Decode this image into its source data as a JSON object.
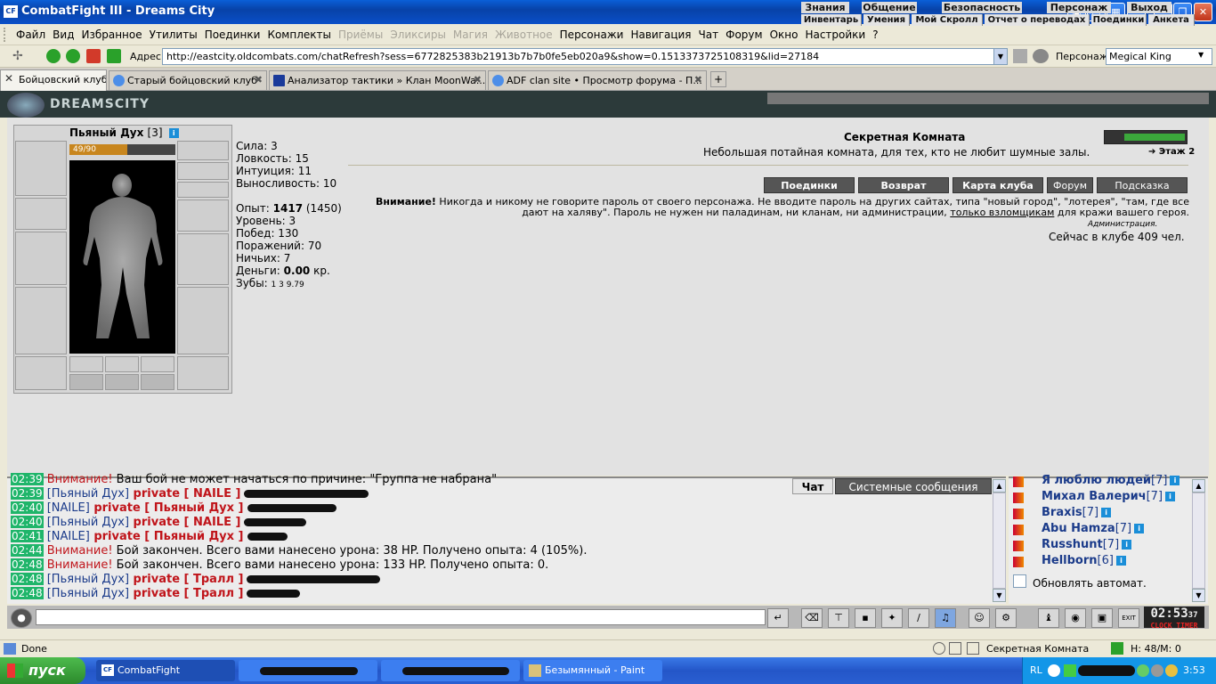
{
  "window": {
    "title": "CombatFight III - Dreams City",
    "app_icon": "CF"
  },
  "menu": {
    "items": [
      {
        "label": "Файл",
        "disabled": false
      },
      {
        "label": "Вид",
        "disabled": false
      },
      {
        "label": "Избранное",
        "disabled": false
      },
      {
        "label": "Утилиты",
        "disabled": false
      },
      {
        "label": "Поединки",
        "disabled": false
      },
      {
        "label": "Комплекты",
        "disabled": false
      },
      {
        "label": "Приёмы",
        "disabled": true
      },
      {
        "label": "Эликсиры",
        "disabled": true
      },
      {
        "label": "Магия",
        "disabled": true
      },
      {
        "label": "Животное",
        "disabled": true
      },
      {
        "label": "Персонажи",
        "disabled": false
      },
      {
        "label": "Навигация",
        "disabled": false
      },
      {
        "label": "Чат",
        "disabled": false
      },
      {
        "label": "Форум",
        "disabled": false
      },
      {
        "label": "Окно",
        "disabled": false
      },
      {
        "label": "Настройки",
        "disabled": false
      },
      {
        "label": "?",
        "disabled": false
      }
    ]
  },
  "address": {
    "label": "Адрес:",
    "url": "http://eastcity.oldcombats.com/chatRefresh?sess=6772825383b21913b7b7b0fe5eb020a9&show=0.1513373725108319&lid=27184",
    "char_label": "Персонаж:",
    "char_value": "Megical King"
  },
  "tabs": [
    {
      "label": "Бойцовский клуб",
      "active": true
    },
    {
      "label": "Старый бойцовский клуб",
      "active": false
    },
    {
      "label": "Анализатор тактики » Клан MoonWa...",
      "active": false
    },
    {
      "label": "ADF clan site • Просмотр форума - П...",
      "active": false
    }
  ],
  "game": {
    "logo": "DREAMSCITY",
    "topnav": [
      "Знания",
      "Общение",
      "Безопасность",
      "Персонаж",
      "Выход"
    ],
    "subnav": [
      "Инвентарь",
      "Умения",
      "Мой Скролл",
      "Отчет о переводах",
      "Поединки",
      "Анкета"
    ]
  },
  "character": {
    "name": "Пьяный Дух",
    "level": "[3]",
    "hp_text": "49/90",
    "hp_fraction": 0.544,
    "stats": [
      {
        "label": "Сила:",
        "value": "3"
      },
      {
        "label": "Ловкость:",
        "value": "15"
      },
      {
        "label": "Интуиция:",
        "value": "11"
      },
      {
        "label": "Выносливость:",
        "value": "10"
      }
    ],
    "exp_label": "Опыт:",
    "exp": "1417",
    "exp_next": "(1450)",
    "level_line": "Уровень: 3",
    "wins": "Побед: 130",
    "losses": "Поражений: 70",
    "draws": "Ничьих: 7",
    "money_label": "Деньги:",
    "money": "0.00",
    "money_unit": "кр.",
    "teeth_label": "Зубы:",
    "teeth": "1  3  9.79"
  },
  "room": {
    "title": "Секретная Комната",
    "desc": "Небольшая потайная комната, для тех, кто не любит шумные залы.",
    "floor": "Этаж 2",
    "buttons": [
      "Поединки",
      "Возврат",
      "Карта клуба",
      "Форум",
      "Подсказка"
    ],
    "warn_bold": "Внимание!",
    "warn_text": "Никогда и никому не говорите пароль от своего персонажа. Не вводите пароль на других сайтах, типа \"новый город\", \"лотерея\", \"там, где все дают на халяву\". Пароль не нужен ни паладинам, ни кланам, ни администрации,",
    "warn_link": "только взломщикам",
    "warn_tail": "для кражи вашего героя.",
    "admin": "Администрация.",
    "online": "Сейчас в клубе 409 чел."
  },
  "chat": {
    "tab_chat": "Чат",
    "tab_system": "Системные сообщения",
    "lines": [
      {
        "time": "02:39",
        "parts": [
          {
            "t": "Внимание!",
            "c": "cwarn"
          },
          {
            "t": " Ваш бой не может начаться по причине: \"Группа не набрана\"",
            "c": ""
          }
        ]
      },
      {
        "time": "02:39",
        "parts": [
          {
            "t": "[Пьяный Дух]",
            "c": "cname"
          },
          {
            "t": " private [ NAILE ]",
            "c": "cpriv"
          }
        ],
        "blur": 140
      },
      {
        "time": "02:40",
        "parts": [
          {
            "t": "[NAILE]",
            "c": "cname"
          },
          {
            "t": " private [ Пьяный Дух ]",
            "c": "cpriv"
          }
        ],
        "blur": 100
      },
      {
        "time": "02:40",
        "parts": [
          {
            "t": "[Пьяный Дух]",
            "c": "cname"
          },
          {
            "t": " private [ NAILE ]",
            "c": "cpriv"
          }
        ],
        "blur": 70
      },
      {
        "time": "02:41",
        "parts": [
          {
            "t": "[NAILE]",
            "c": "cname"
          },
          {
            "t": " private [ Пьяный Дух ]",
            "c": "cpriv"
          }
        ],
        "blur": 45
      },
      {
        "time": "02:44",
        "parts": [
          {
            "t": "Внимание!",
            "c": "cwarn"
          },
          {
            "t": " Бой закончен. Всего вами нанесено урона: 38 HP. Получено опыта: 4 (105%).",
            "c": ""
          }
        ]
      },
      {
        "time": "02:48",
        "parts": [
          {
            "t": "Внимание!",
            "c": "cwarn"
          },
          {
            "t": " Бой закончен. Всего вами нанесено урона: 133 HP. Получено опыта: 0.",
            "c": ""
          }
        ]
      },
      {
        "time": "02:48",
        "parts": [
          {
            "t": "[Пьяный Дух]",
            "c": "cname"
          },
          {
            "t": " private [ Тралл ]",
            "c": "cpriv"
          }
        ],
        "blur": 150
      },
      {
        "time": "02:48",
        "parts": [
          {
            "t": "[Пьяный Дух]",
            "c": "cname"
          },
          {
            "t": " private [ Тралл ]",
            "c": "cpriv"
          }
        ],
        "blur": 60
      }
    ]
  },
  "users": {
    "list": [
      {
        "name": "Я люблю людей",
        "level": "[7]"
      },
      {
        "name": "Михал Валерич",
        "level": "[7]"
      },
      {
        "name": "Braxis",
        "level": "[7]"
      },
      {
        "name": "Abu Hamza",
        "level": "[7]"
      },
      {
        "name": "Russhunt",
        "level": "[7]"
      },
      {
        "name": "Hellborn",
        "level": "[6]"
      }
    ],
    "auto_label": "Обновлять автомат."
  },
  "clock": {
    "time": "02:53",
    "sec": "37",
    "sub": "CLOCK  TIMER"
  },
  "status": {
    "text": "Done",
    "room": "Секретная Комната",
    "hp": "H: 48/M: 0"
  },
  "taskbar": {
    "start": "пуск",
    "tasks": [
      {
        "label": "CombatFight",
        "active": true
      },
      {
        "label": "",
        "active": false
      },
      {
        "label": "",
        "active": false
      },
      {
        "label": "Безымянный - Paint",
        "active": false
      }
    ],
    "lang": "RL",
    "time": "3:53"
  },
  "colors": {
    "accent": "#0842a8",
    "warn": "#c0141a",
    "name": "#1b3b8a",
    "time_bg": "#1fb56a"
  }
}
